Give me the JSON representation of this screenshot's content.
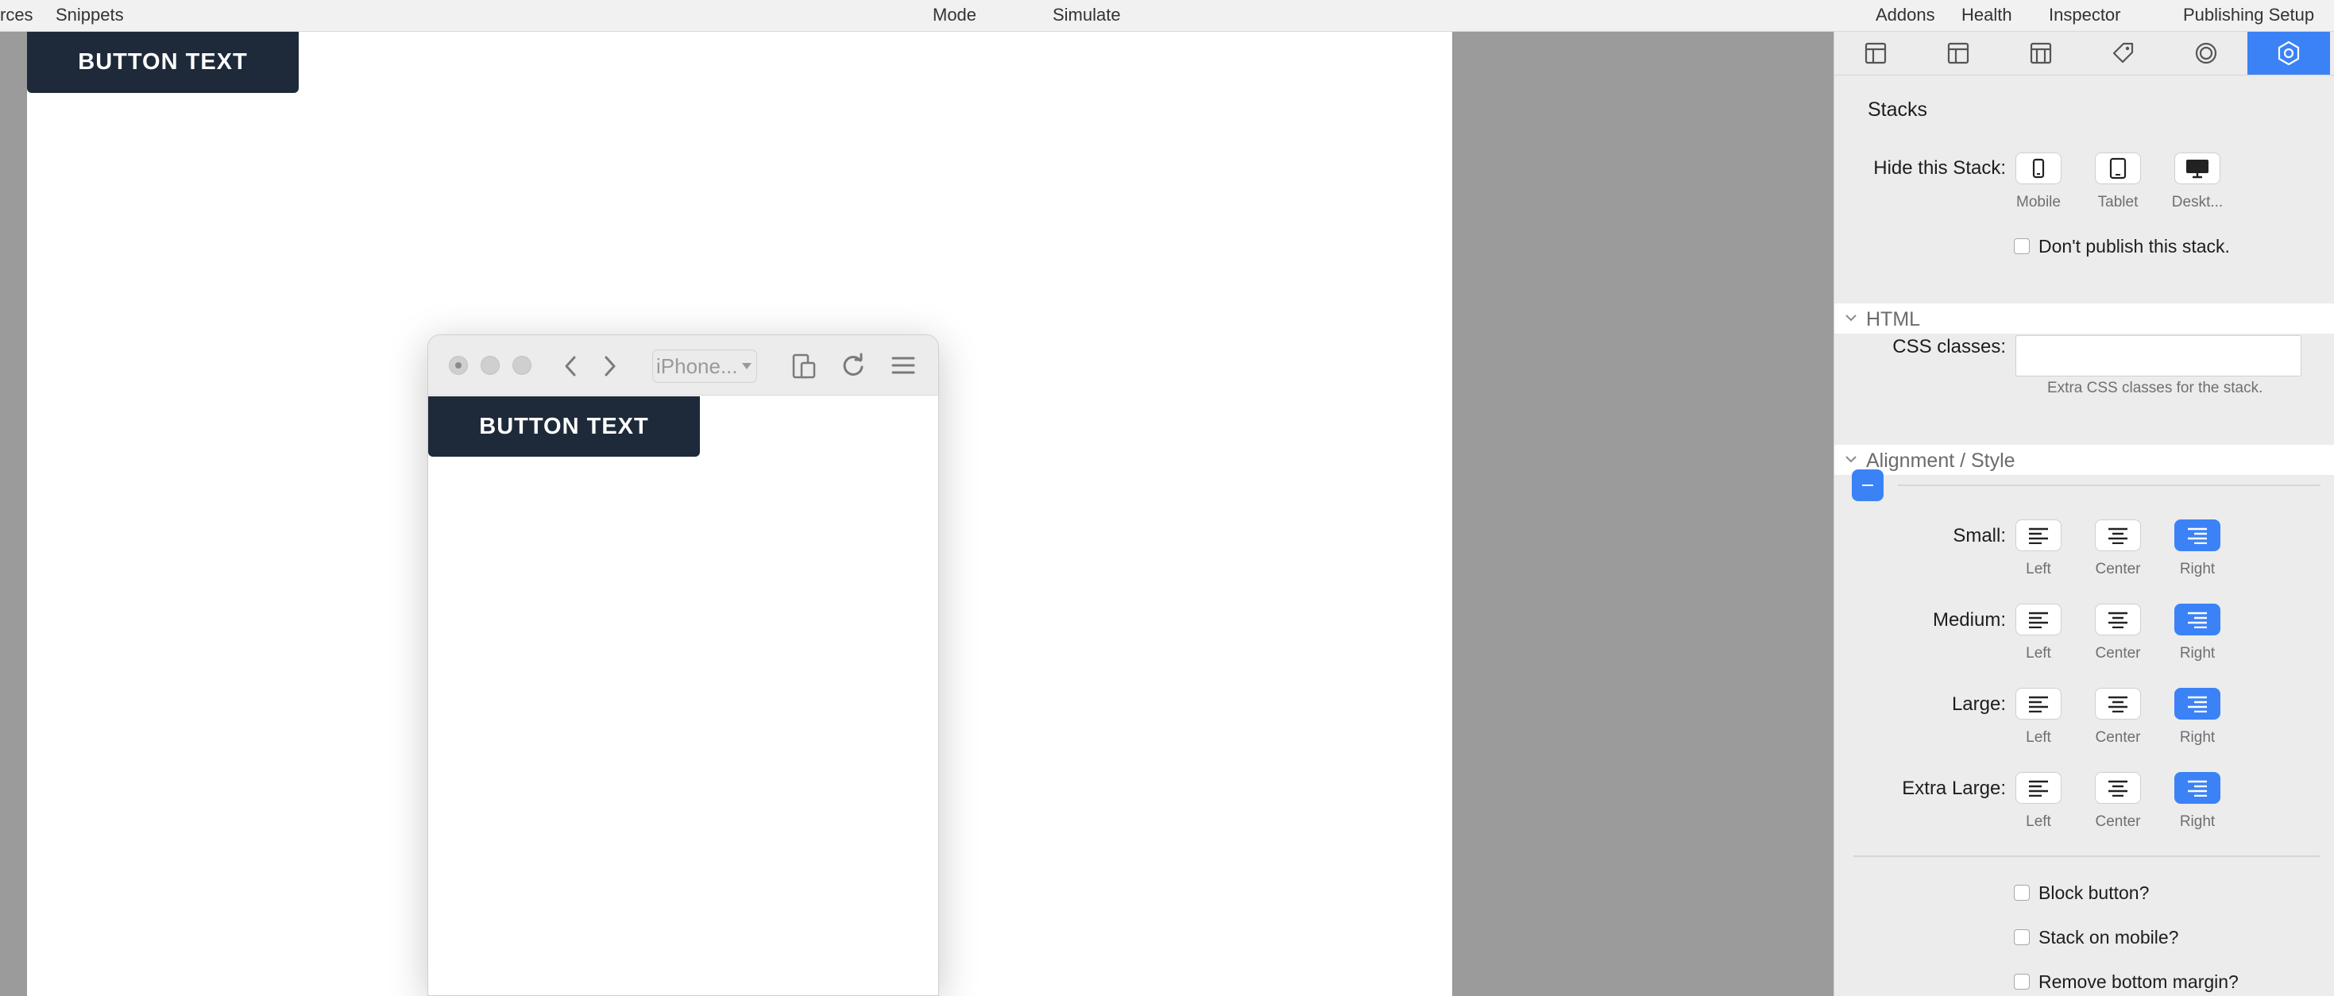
{
  "topbar": {
    "resources": "rces",
    "snippets": "Snippets",
    "mode": "Mode",
    "simulate": "Simulate",
    "addons": "Addons",
    "health": "Health",
    "inspector": "Inspector",
    "publishing": "Publishing Setup"
  },
  "canvas": {
    "button_text": "BUTTON TEXT"
  },
  "simulator": {
    "device": "iPhone...",
    "button_text": "BUTTON TEXT"
  },
  "inspector": {
    "tabs": [
      "layout-icon",
      "layout-icon",
      "layout-icon",
      "tag-icon",
      "circle-icon",
      "gear-icon"
    ],
    "section": "Stacks",
    "hide_label": "Hide this Stack:",
    "hide_options": [
      "Mobile",
      "Tablet",
      "Deskt..."
    ],
    "dont_publish": "Don't publish this stack.",
    "html_header": "HTML",
    "css_label": "CSS classes:",
    "css_hint": "Extra CSS classes for the stack.",
    "align_header": "Alignment / Style",
    "align_rows": [
      {
        "label": "Small:",
        "options": [
          "Left",
          "Center",
          "Right"
        ],
        "selected": "Right"
      },
      {
        "label": "Medium:",
        "options": [
          "Left",
          "Center",
          "Right"
        ],
        "selected": "Right"
      },
      {
        "label": "Large:",
        "options": [
          "Left",
          "Center",
          "Right"
        ],
        "selected": "Right"
      },
      {
        "label": "Extra Large:",
        "options": [
          "Left",
          "Center",
          "Right"
        ],
        "selected": "Right"
      }
    ],
    "block_button": "Block button?",
    "stack_mobile": "Stack on mobile?",
    "remove_margin": "Remove bottom margin?"
  },
  "colors": {
    "accent": "#3b82f6",
    "button_bg": "#1e2a3a"
  }
}
